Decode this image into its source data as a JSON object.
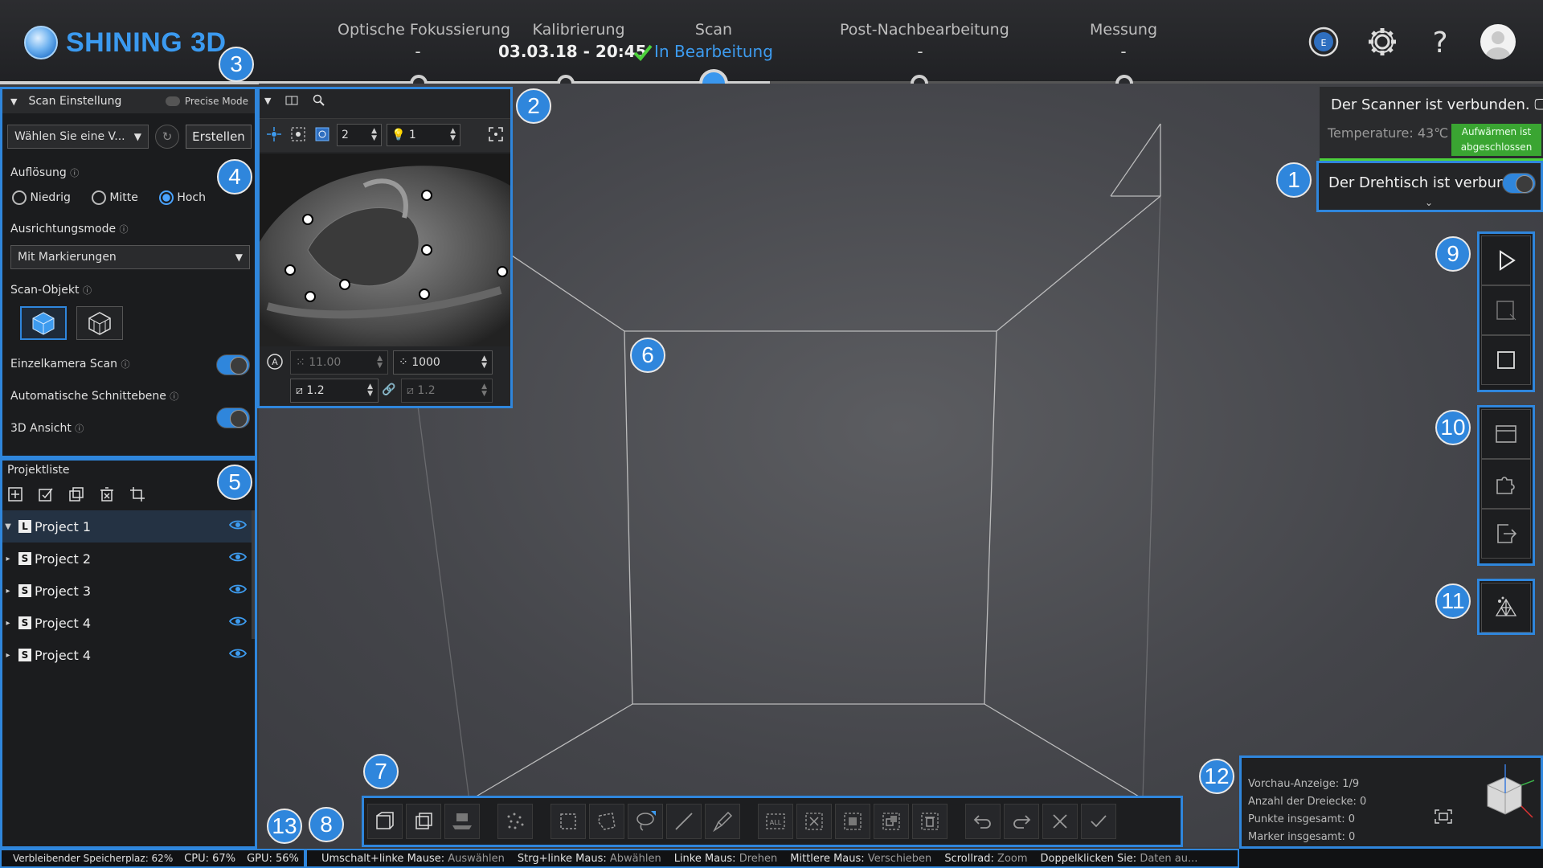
{
  "app": {
    "brand": "SHINING 3D",
    "accent": "#2f86dc"
  },
  "steps": [
    {
      "name": "Optische Fokussierung",
      "sub": "-"
    },
    {
      "name": "Kalibrierung",
      "sub": "03.03.18 - 20:45"
    },
    {
      "name": "Scan",
      "sub": "In Bearbeitung"
    },
    {
      "name": "Post-Nachbearbeitung",
      "sub": "-"
    },
    {
      "name": "Messung",
      "sub": "-"
    }
  ],
  "badges": [
    "1",
    "2",
    "3",
    "4",
    "5",
    "6",
    "7",
    "8",
    "9",
    "10",
    "11",
    "12",
    "13"
  ],
  "scan_settings": {
    "title": "Scan Einstellung",
    "precise_mode": "Precise Mode",
    "template_placeholder": "Wählen Sie eine V...",
    "create_label": "Erstellen",
    "resolution_label": "Auflösung",
    "resolution_options": [
      "Niedrig",
      "Mitte",
      "Hoch"
    ],
    "resolution_selected": "Hoch",
    "alignment_label": "Ausrichtungsmode",
    "alignment_value": "Mit Markierungen",
    "scan_object_label": "Scan-Objekt",
    "single_camera_label": "Einzelkamera Scan",
    "auto_cut_label": "Automatische Schnittebene",
    "view3d_label": "3D Ansicht"
  },
  "camera_panel": {
    "spin1": "2",
    "spin2": "1",
    "exposure": "11.00",
    "points": "1000",
    "gain_l": "1.2",
    "gain_r": "1.2"
  },
  "project_list": {
    "title": "Projektliste",
    "items": [
      {
        "badge": "L",
        "name": "Project 1"
      },
      {
        "badge": "S",
        "name": "Project 2"
      },
      {
        "badge": "S",
        "name": "Project 3"
      },
      {
        "badge": "S",
        "name": "Project 4"
      },
      {
        "badge": "S",
        "name": "Project 4"
      }
    ]
  },
  "status": {
    "scanner": "Der Scanner ist verbunden.",
    "temperature_label": "Temperature:",
    "temperature_value": "43℃",
    "warmup": "Aufwärmen ist abgeschlossen",
    "turntable": "Der Drehtisch ist verbun.."
  },
  "info": {
    "preview": "Vorchau-Anzeige:",
    "preview_val": "1/9",
    "triangles": "Anzahl der Dreiecke:",
    "triangles_val": "0",
    "points": "Punkte insgesamt:",
    "points_val": "0",
    "markers": "Marker insgesamt:",
    "markers_val": "0"
  },
  "footer": {
    "memory": "Verbleibender Speicherplaz: 62%",
    "cpu": "CPU: 67%",
    "gpu": "GPU: 56%",
    "hints": [
      {
        "k": "Umschalt+linke Mause:",
        "v": "Auswählen"
      },
      {
        "k": "Strg+linke Maus:",
        "v": "Abwählen"
      },
      {
        "k": "Linke Maus:",
        "v": "Drehen"
      },
      {
        "k": "Mittlere Maus:",
        "v": "Verschieben"
      },
      {
        "k": "Scrollrad:",
        "v": "Zoom"
      },
      {
        "k": "Doppelklicken Sie:",
        "v": "Daten au..."
      }
    ]
  }
}
